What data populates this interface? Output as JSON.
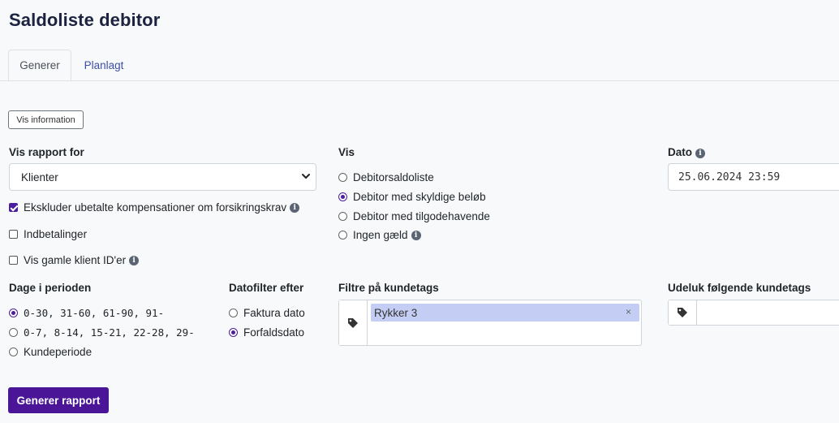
{
  "page": {
    "title": "Saldoliste debitor"
  },
  "tabs": [
    {
      "label": "Generer"
    },
    {
      "label": "Planlagt"
    }
  ],
  "info_button": "Vis information",
  "report_for": {
    "label": "Vis rapport for",
    "selected": "Klienter",
    "checkboxes": [
      {
        "label": "Ekskluder ubetalte kompensationer om forsikringskrav",
        "checked": true,
        "info": true
      },
      {
        "label": "Indbetalinger",
        "checked": false,
        "info": false
      },
      {
        "label": "Vis gamle klient ID'er",
        "checked": false,
        "info": true
      }
    ]
  },
  "vis": {
    "label": "Vis",
    "options": [
      {
        "label": "Debitorsaldoliste",
        "checked": false
      },
      {
        "label": "Debitor med skyldige beløb",
        "checked": true
      },
      {
        "label": "Debitor med tilgodehavende",
        "checked": false
      },
      {
        "label": "Ingen gæld",
        "checked": false
      }
    ]
  },
  "dato": {
    "label": "Dato",
    "value": "25.06.2024 23:59"
  },
  "periods": {
    "label": "Dage i perioden",
    "options": [
      {
        "label": "0-30, 31-60, 61-90, 91-",
        "checked": true
      },
      {
        "label": "0-7, 8-14, 15-21, 22-28, 29-",
        "checked": false
      },
      {
        "label": "Kundeperiode",
        "checked": false
      }
    ]
  },
  "datefilter": {
    "label": "Datofilter efter",
    "options": [
      {
        "label": "Faktura dato",
        "checked": false
      },
      {
        "label": "Forfaldsdato",
        "checked": true
      }
    ]
  },
  "customer_tags": {
    "label": "Filtre på kundetags",
    "tags": [
      "Rykker 3"
    ],
    "remove_glyph": "×"
  },
  "exclude_tags": {
    "label": "Udeluk følgende kundetags"
  },
  "generate_button": "Generer rapport",
  "colors": {
    "accent": "#4a1597",
    "tag_bg": "#c4cdf3",
    "link": "#3b4fa8"
  },
  "icons": {
    "info": "i"
  }
}
